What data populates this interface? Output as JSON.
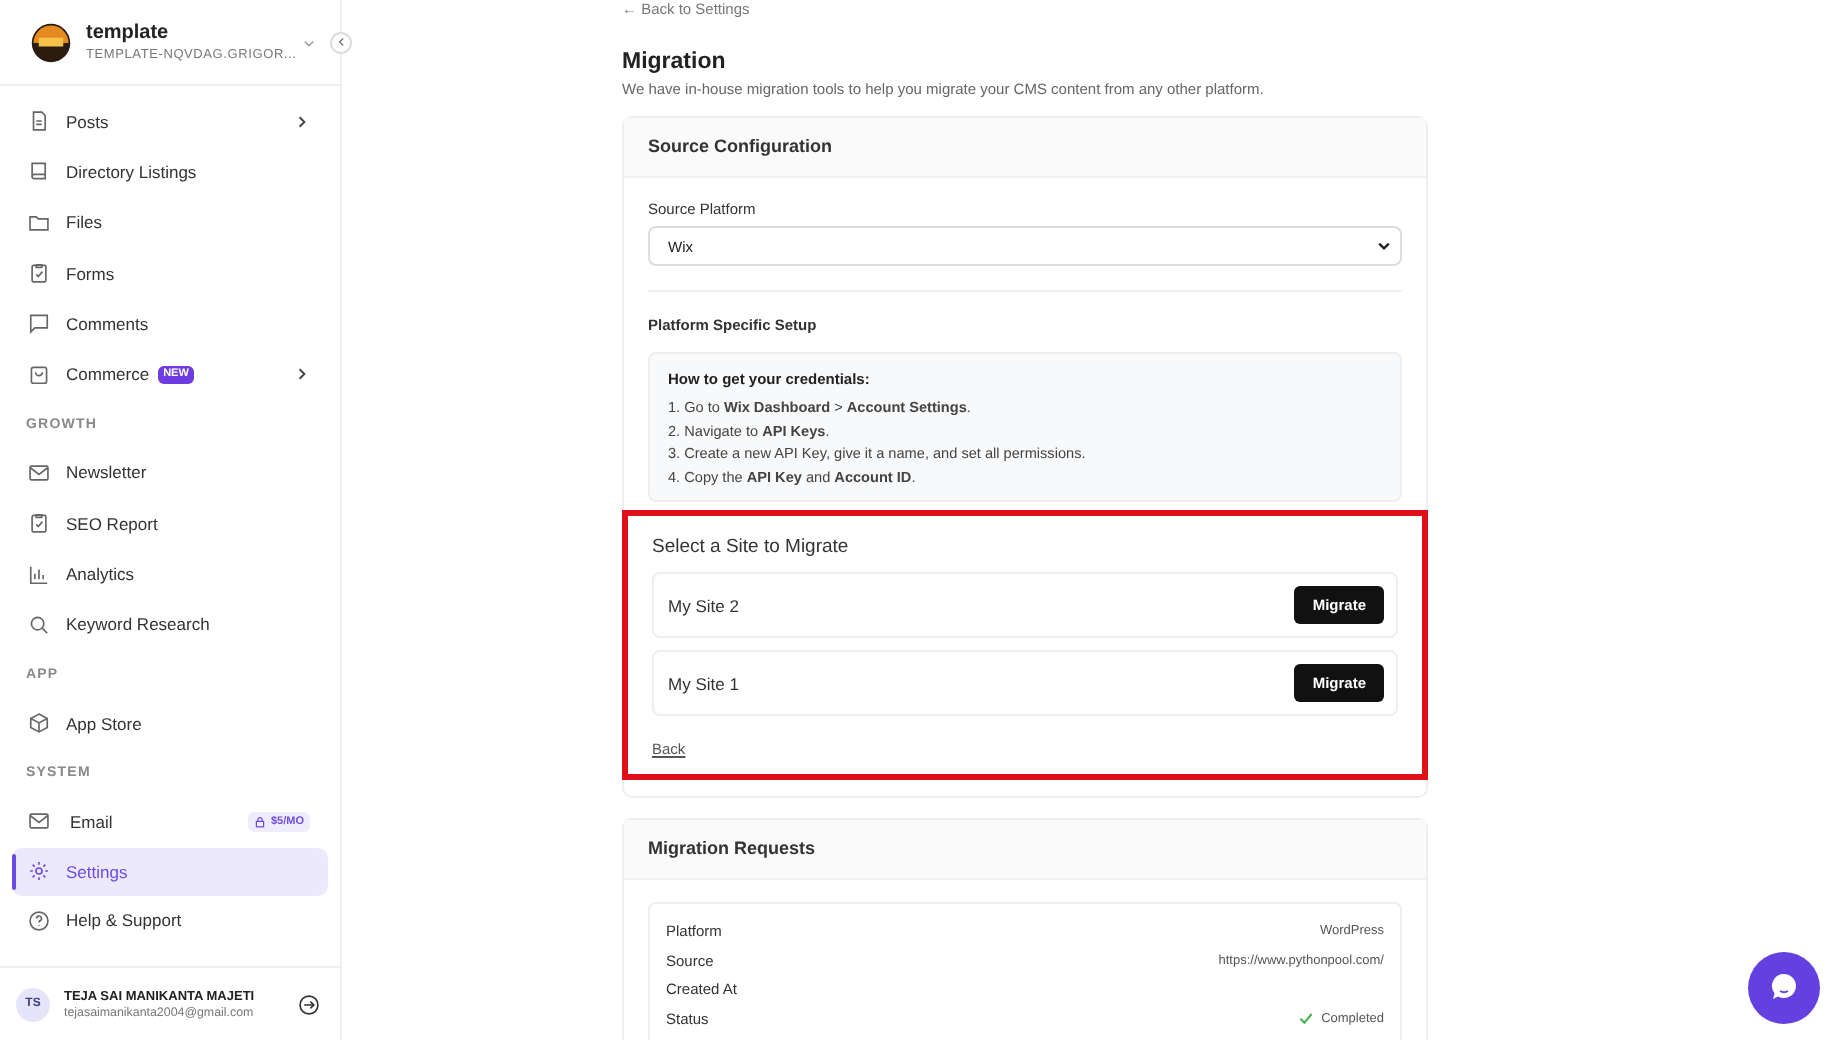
{
  "sidebar": {
    "workspace": {
      "name": "template",
      "domain": "TEMPLATE-NQVDAG.GRIGOR..."
    },
    "groups": [
      {
        "items": [
          {
            "label": "Posts",
            "submenu": true,
            "selected": false
          },
          {
            "label": "Directory Listings",
            "submenu": false,
            "selected": false
          },
          {
            "label": "Files",
            "submenu": false,
            "selected": false
          },
          {
            "label": "Forms",
            "submenu": false,
            "selected": false
          },
          {
            "label": "Comments",
            "submenu": false,
            "selected": false
          },
          {
            "label": "Commerce",
            "badge": "NEW",
            "submenu": true,
            "selected": false
          }
        ]
      },
      {
        "heading": "GROWTH",
        "items": [
          {
            "label": "Newsletter",
            "submenu": false,
            "selected": false
          },
          {
            "label": "SEO Report",
            "submenu": false,
            "selected": false
          },
          {
            "label": "Analytics",
            "submenu": false,
            "selected": false
          },
          {
            "label": "Keyword Research",
            "submenu": false,
            "selected": false
          }
        ]
      },
      {
        "heading": "APP",
        "items": [
          {
            "label": "App Store",
            "submenu": false,
            "selected": false
          }
        ]
      },
      {
        "heading": "SYSTEM",
        "items": [
          {
            "label": "Email",
            "price": "$5/MO",
            "submenu": false,
            "selected": false
          },
          {
            "label": "Settings",
            "submenu": false,
            "selected": true
          },
          {
            "label": "Help & Support",
            "submenu": false,
            "selected": false
          }
        ]
      }
    ],
    "user": {
      "initials": "TS",
      "name": "TEJA SAI MANIKANTA MAJETI",
      "email": "tejasaimanikanta2004@gmail.com"
    }
  },
  "main": {
    "back_link": "← Back to Settings",
    "title": "Migration",
    "subtitle": "We have in-house migration tools to help you migrate your CMS content from any other platform.",
    "source_card": {
      "title": "Source Configuration",
      "platform_label": "Source Platform",
      "platform_value": "Wix",
      "setup_title": "Platform Specific Setup",
      "instructions": {
        "title": "How to get your credentials:",
        "steps": [
          "1. Go to **Wix Dashboard** > **Account Settings**.",
          "2. Navigate to **API Keys**.",
          "3. Create a new API Key, give it a name, and set all permissions.",
          "4. Copy the **API Key** and **Account ID**."
        ]
      },
      "site_picker": {
        "title": "Select a Site to Migrate",
        "highlighted": true,
        "sites": [
          {
            "name": "My Site 2",
            "action": "Migrate"
          },
          {
            "name": "My Site 1",
            "action": "Migrate"
          }
        ],
        "back": "Back"
      }
    },
    "requests_card": {
      "title": "Migration Requests",
      "fields": [
        {
          "label": "Platform",
          "value": "WordPress",
          "kind": "text"
        },
        {
          "label": "Source",
          "value": "https://www.pythonpool.com/",
          "kind": "text"
        },
        {
          "label": "Created At",
          "kind": "text"
        },
        {
          "label": "Status",
          "value": "Completed",
          "kind": "status"
        }
      ]
    }
  }
}
